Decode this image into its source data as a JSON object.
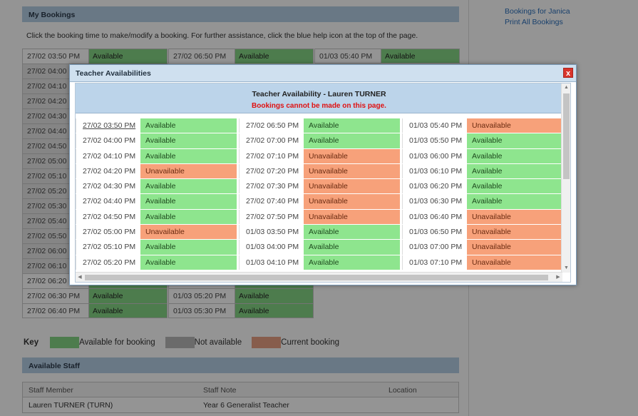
{
  "right_links": [
    "Bookings for Janica",
    "Print All Bookings"
  ],
  "my_bookings": {
    "title": "My Bookings",
    "intro": "Click the booking time to make/modify a booking. For further assistance, click the blue help icon at the top of the page.",
    "columns": [
      [
        {
          "time": "27/02 03:50 PM",
          "status": "Available"
        },
        {
          "time": "27/02 04:00 PM",
          "status": ""
        },
        {
          "time": "27/02 04:10 PM",
          "status": ""
        },
        {
          "time": "27/02 04:20 PM",
          "status": ""
        },
        {
          "time": "27/02 04:30 PM",
          "status": ""
        },
        {
          "time": "27/02 04:40 PM",
          "status": ""
        },
        {
          "time": "27/02 04:50 PM",
          "status": ""
        },
        {
          "time": "27/02 05:00 PM",
          "status": ""
        },
        {
          "time": "27/02 05:10 PM",
          "status": ""
        },
        {
          "time": "27/02 05:20 PM",
          "status": ""
        },
        {
          "time": "27/02 05:30 PM",
          "status": ""
        },
        {
          "time": "27/02 05:40 PM",
          "status": ""
        },
        {
          "time": "27/02 05:50 PM",
          "status": ""
        },
        {
          "time": "27/02 06:00 PM",
          "status": ""
        },
        {
          "time": "27/02 06:10 PM",
          "status": ""
        },
        {
          "time": "27/02 06:20 PM",
          "status": "Available"
        },
        {
          "time": "27/02 06:30 PM",
          "status": "Available"
        },
        {
          "time": "27/02 06:40 PM",
          "status": "Available"
        }
      ],
      [
        {
          "time": "27/02 06:50 PM",
          "status": "Available"
        },
        {
          "time": "01/03 05:10 PM",
          "status": "Available"
        },
        {
          "time": "01/03 05:20 PM",
          "status": "Available"
        },
        {
          "time": "01/03 05:30 PM",
          "status": "Available"
        }
      ],
      [
        {
          "time": "01/03 05:40 PM",
          "status": "Available"
        }
      ]
    ]
  },
  "key": {
    "title": "Key",
    "items": [
      {
        "label": "Available for booking",
        "color": "#86d686"
      },
      {
        "label": "Not available",
        "color": "#b8b8b8"
      },
      {
        "label": "Current booking",
        "color": "#e8a083"
      }
    ]
  },
  "available_staff": {
    "title": "Available Staff",
    "headers": [
      "Staff Member",
      "Staff Note",
      "Location"
    ],
    "rows": [
      [
        "Lauren TURNER (TURN)",
        "Year 6 Generalist Teacher",
        ""
      ]
    ]
  },
  "modal": {
    "title": "Teacher Availabilities",
    "close_label": "x",
    "heading": "Teacher Availability - Lauren TURNER",
    "warning": "Bookings cannot be made on this page.",
    "columns": [
      [
        {
          "time": "27/02 03:50 PM",
          "status": "Available"
        },
        {
          "time": "27/02 04:00 PM",
          "status": "Available"
        },
        {
          "time": "27/02 04:10 PM",
          "status": "Available"
        },
        {
          "time": "27/02 04:20 PM",
          "status": "Unavailable"
        },
        {
          "time": "27/02 04:30 PM",
          "status": "Available"
        },
        {
          "time": "27/02 04:40 PM",
          "status": "Available"
        },
        {
          "time": "27/02 04:50 PM",
          "status": "Available"
        },
        {
          "time": "27/02 05:00 PM",
          "status": "Unavailable"
        },
        {
          "time": "27/02 05:10 PM",
          "status": "Available"
        },
        {
          "time": "27/02 05:20 PM",
          "status": "Available"
        }
      ],
      [
        {
          "time": "27/02 06:50 PM",
          "status": "Available"
        },
        {
          "time": "27/02 07:00 PM",
          "status": "Available"
        },
        {
          "time": "27/02 07:10 PM",
          "status": "Unavailable"
        },
        {
          "time": "27/02 07:20 PM",
          "status": "Unavailable"
        },
        {
          "time": "27/02 07:30 PM",
          "status": "Unavailable"
        },
        {
          "time": "27/02 07:40 PM",
          "status": "Unavailable"
        },
        {
          "time": "27/02 07:50 PM",
          "status": "Unavailable"
        },
        {
          "time": "01/03 03:50 PM",
          "status": "Available"
        },
        {
          "time": "01/03 04:00 PM",
          "status": "Available"
        },
        {
          "time": "01/03 04:10 PM",
          "status": "Available"
        }
      ],
      [
        {
          "time": "01/03 05:40 PM",
          "status": "Unavailable"
        },
        {
          "time": "01/03 05:50 PM",
          "status": "Available"
        },
        {
          "time": "01/03 06:00 PM",
          "status": "Available"
        },
        {
          "time": "01/03 06:10 PM",
          "status": "Available"
        },
        {
          "time": "01/03 06:20 PM",
          "status": "Available"
        },
        {
          "time": "01/03 06:30 PM",
          "status": "Available"
        },
        {
          "time": "01/03 06:40 PM",
          "status": "Unavailable"
        },
        {
          "time": "01/03 06:50 PM",
          "status": "Unavailable"
        },
        {
          "time": "01/03 07:00 PM",
          "status": "Unavailable"
        },
        {
          "time": "01/03 07:10 PM",
          "status": "Unavailable"
        }
      ]
    ]
  }
}
